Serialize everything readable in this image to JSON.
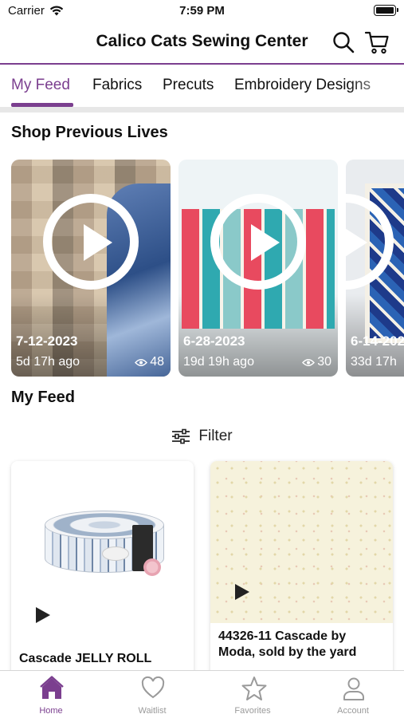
{
  "status_bar": {
    "carrier": "Carrier",
    "time": "7:59 PM"
  },
  "header": {
    "title": "Calico Cats Sewing Center",
    "icons": [
      "search-icon",
      "cart-icon"
    ]
  },
  "tabs": [
    {
      "label": "My Feed",
      "active": true
    },
    {
      "label": "Fabrics",
      "active": false
    },
    {
      "label": "Precuts",
      "active": false
    },
    {
      "label": "Embroidery Designs",
      "active": false
    }
  ],
  "shop_previous_lives": {
    "title": "Shop Previous Lives",
    "items": [
      {
        "date": "7-12-2023",
        "ago": "5d 17h ago",
        "views": "48"
      },
      {
        "date": "6-28-2023",
        "ago": "19d 19h ago",
        "views": "30"
      },
      {
        "date": "6-14-202",
        "ago": "33d 17h",
        "views": ""
      }
    ]
  },
  "feed": {
    "title": "My Feed",
    "filter_label": "Filter",
    "products": [
      {
        "title": "Cascade JELLY ROLL"
      },
      {
        "title": "44326-11 Cascade by Moda, sold by the yard"
      }
    ]
  },
  "tabbar": {
    "items": [
      {
        "label": "Home",
        "icon": "home-icon",
        "active": true
      },
      {
        "label": "Waitlist",
        "icon": "heart-icon",
        "active": false
      },
      {
        "label": "Favorites",
        "icon": "star-icon",
        "active": false
      },
      {
        "label": "Account",
        "icon": "person-icon",
        "active": false
      }
    ]
  },
  "colors": {
    "accent": "#7b3f8f",
    "inactive": "#9a9a9a"
  }
}
